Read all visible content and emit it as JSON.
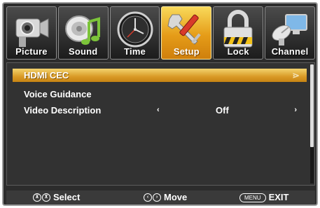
{
  "tabs": [
    {
      "label": "Picture",
      "icon": "camcorder-icon",
      "active": false
    },
    {
      "label": "Sound",
      "icon": "speaker-music-icon",
      "active": false
    },
    {
      "label": "Time",
      "icon": "clock-icon",
      "active": false
    },
    {
      "label": "Setup",
      "icon": "wrench-screwdriver-icon",
      "active": true
    },
    {
      "label": "Lock",
      "icon": "padlock-icon",
      "active": false
    },
    {
      "label": "Channel",
      "icon": "satellite-dish-icon",
      "active": false
    }
  ],
  "menu": {
    "items": [
      {
        "label": "HDMI CEC",
        "selected": true,
        "arrow": "⋗"
      },
      {
        "label": "Voice Guidance",
        "selected": false
      },
      {
        "label": "Video Description",
        "selected": false,
        "value": "Off",
        "left_arrow": "‹",
        "right_arrow": "›"
      }
    ]
  },
  "footer": {
    "select_keys": [
      "⊼",
      "⊻"
    ],
    "select_label": "Select",
    "move_keys": [
      "‹",
      "›"
    ],
    "move_label": "Move",
    "menu_key": "MENU",
    "exit_label": "EXIT"
  },
  "colors": {
    "accent": "#e59c18",
    "background": "#2c2c2c",
    "text": "#ffffff"
  }
}
